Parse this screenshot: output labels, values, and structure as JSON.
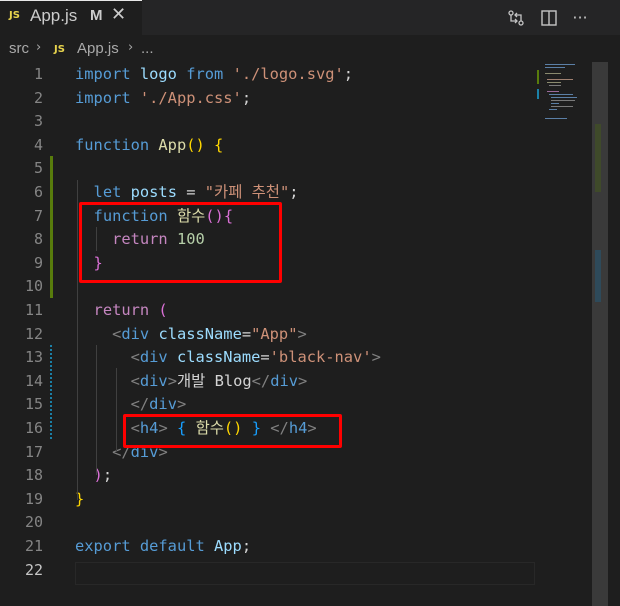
{
  "tab": {
    "file_icon": "JS",
    "label": "App.js",
    "status": "M",
    "close": "✕"
  },
  "toolbar": {
    "icons": [
      "source-control-compare-icon",
      "split-editor-icon",
      "more-actions-icon"
    ],
    "more": "···"
  },
  "breadcrumb": {
    "folder": "src",
    "file_icon": "JS",
    "file": "App.js",
    "symbol": "..."
  },
  "editor": {
    "current_line": 22,
    "lines": [
      {
        "number": 1,
        "tokens": [
          [
            "kw",
            "import "
          ],
          [
            "var",
            "logo "
          ],
          [
            "kw",
            "from "
          ],
          [
            "str",
            "'./logo.svg'"
          ],
          [
            "txt",
            ";"
          ]
        ]
      },
      {
        "number": 2,
        "tokens": [
          [
            "kw",
            "import "
          ],
          [
            "str",
            "'./App.css'"
          ],
          [
            "txt",
            ";"
          ]
        ]
      },
      {
        "number": 3,
        "tokens": []
      },
      {
        "number": 4,
        "tokens": [
          [
            "kw",
            "function "
          ],
          [
            "fn",
            "App"
          ],
          [
            "br1",
            "()"
          ],
          [
            "txt",
            " "
          ],
          [
            "br1",
            "{"
          ]
        ]
      },
      {
        "number": 5,
        "tokens": []
      },
      {
        "number": 6,
        "tokens": [
          [
            "txt",
            "  "
          ],
          [
            "kw",
            "let "
          ],
          [
            "var",
            "posts "
          ],
          [
            "txt",
            "= "
          ],
          [
            "str",
            "\"카페 추천\""
          ],
          [
            "txt",
            ";"
          ]
        ]
      },
      {
        "number": 7,
        "tokens": [
          [
            "txt",
            "  "
          ],
          [
            "kw",
            "function "
          ],
          [
            "fn",
            "함수"
          ],
          [
            "br2",
            "(){"
          ]
        ]
      },
      {
        "number": 8,
        "tokens": [
          [
            "txt",
            "    "
          ],
          [
            "ctl",
            "return "
          ],
          [
            "num",
            "100"
          ]
        ]
      },
      {
        "number": 9,
        "tokens": [
          [
            "txt",
            "  "
          ],
          [
            "br2",
            "}"
          ]
        ]
      },
      {
        "number": 10,
        "tokens": []
      },
      {
        "number": 11,
        "tokens": [
          [
            "txt",
            "  "
          ],
          [
            "ctl",
            "return "
          ],
          [
            "br2",
            "("
          ]
        ]
      },
      {
        "number": 12,
        "tokens": [
          [
            "txt",
            "    "
          ],
          [
            "tagp",
            "<"
          ],
          [
            "tag",
            "div "
          ],
          [
            "attr",
            "className"
          ],
          [
            "txt",
            "="
          ],
          [
            "str",
            "\"App\""
          ],
          [
            "tagp",
            ">"
          ]
        ]
      },
      {
        "number": 13,
        "tokens": [
          [
            "txt",
            "      "
          ],
          [
            "tagp",
            "<"
          ],
          [
            "tag",
            "div "
          ],
          [
            "attr",
            "className"
          ],
          [
            "txt",
            "="
          ],
          [
            "str",
            "'black-nav'"
          ],
          [
            "tagp",
            ">"
          ]
        ]
      },
      {
        "number": 14,
        "tokens": [
          [
            "txt",
            "      "
          ],
          [
            "tagp",
            "<"
          ],
          [
            "tag",
            "div"
          ],
          [
            "tagp",
            ">"
          ],
          [
            "txt",
            "개발 Blog"
          ],
          [
            "tagp",
            "</"
          ],
          [
            "tag",
            "div"
          ],
          [
            "tagp",
            ">"
          ]
        ]
      },
      {
        "number": 15,
        "tokens": [
          [
            "txt",
            "      "
          ],
          [
            "tagp",
            "</"
          ],
          [
            "tag",
            "div"
          ],
          [
            "tagp",
            ">"
          ]
        ]
      },
      {
        "number": 16,
        "tokens": [
          [
            "txt",
            "      "
          ],
          [
            "tagp",
            "<"
          ],
          [
            "tag",
            "h4"
          ],
          [
            "tagp",
            ">"
          ],
          [
            "txt",
            " "
          ],
          [
            "br3",
            "{"
          ],
          [
            "txt",
            " "
          ],
          [
            "fn",
            "함수"
          ],
          [
            "br1",
            "()"
          ],
          [
            "txt",
            " "
          ],
          [
            "br3",
            "}"
          ],
          [
            "txt",
            " "
          ],
          [
            "tagp",
            "</"
          ],
          [
            "tag",
            "h4"
          ],
          [
            "tagp",
            ">"
          ]
        ]
      },
      {
        "number": 17,
        "tokens": [
          [
            "txt",
            "    "
          ],
          [
            "tagp",
            "</"
          ],
          [
            "tag",
            "div"
          ],
          [
            "tagp",
            ">"
          ]
        ]
      },
      {
        "number": 18,
        "tokens": [
          [
            "txt",
            "  "
          ],
          [
            "br2",
            ")"
          ],
          [
            "txt",
            ";"
          ]
        ]
      },
      {
        "number": 19,
        "tokens": [
          [
            "br1",
            "}"
          ]
        ]
      },
      {
        "number": 20,
        "tokens": []
      },
      {
        "number": 21,
        "tokens": [
          [
            "kw",
            "export "
          ],
          [
            "kw",
            "default "
          ],
          [
            "var",
            "App"
          ],
          [
            "txt",
            ";"
          ]
        ]
      },
      {
        "number": 22,
        "tokens": []
      }
    ]
  },
  "colors": {
    "keyword": "#569cd6",
    "control": "#c586c0",
    "function": "#dcdcaa",
    "string": "#ce9178",
    "number": "#b5cea8",
    "variable": "#9cdcfe",
    "highlight_box": "#ff0000",
    "gutter_added": "#587c0c",
    "gutter_modified": "#1b81a8"
  }
}
